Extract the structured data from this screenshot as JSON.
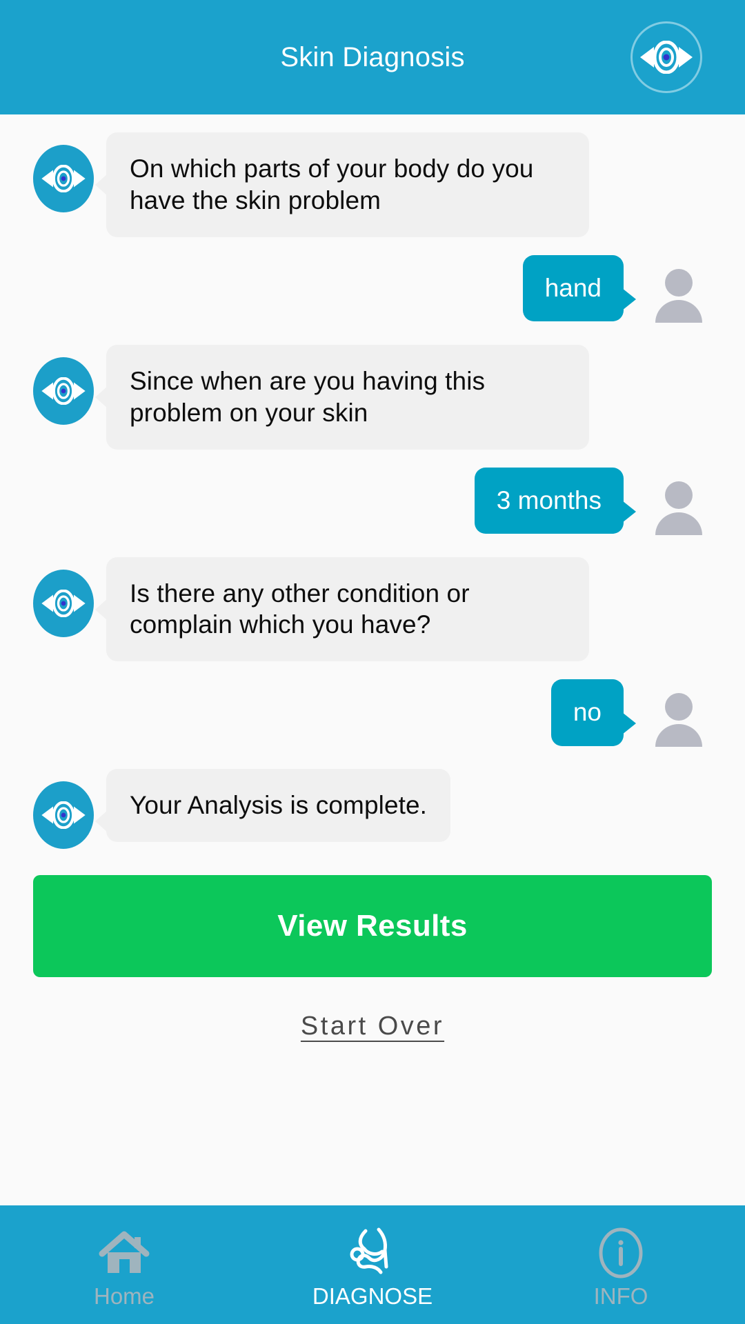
{
  "header": {
    "title": "Skin Diagnosis",
    "logo_icon": "eye-arrows-logo-icon"
  },
  "theme": {
    "header_bg": "#1BA2CC",
    "bot_avatar_bg": "#1C9FC9",
    "bot_bubble_bg": "#f0f0f0",
    "user_bubble_bg": "#00A2C4",
    "page_bg": "#fafafa",
    "primary_button_bg": "#0CC75A",
    "user_avatar_gray": "#B8BAC4",
    "nav_inactive": "#9FB4BE",
    "nav_active": "#FFFFFF"
  },
  "chat": {
    "messages": [
      {
        "sender": "bot",
        "text": "On which parts of your body do you have the skin problem"
      },
      {
        "sender": "user",
        "text": "hand"
      },
      {
        "sender": "bot",
        "text": "Since when are you having this problem on your skin"
      },
      {
        "sender": "user",
        "text": "3 months"
      },
      {
        "sender": "bot",
        "text": "Is there any other condition or complain which you have?"
      },
      {
        "sender": "user",
        "text": "no"
      },
      {
        "sender": "bot",
        "text": "Your Analysis is complete."
      }
    ]
  },
  "actions": {
    "view_results_label": "View Results",
    "start_over_label": "Start Over"
  },
  "bottom_nav": {
    "items": [
      {
        "label": "Home",
        "icon": "home-icon",
        "active": false
      },
      {
        "label": "DIAGNOSE",
        "icon": "stethoscope-icon",
        "active": true
      },
      {
        "label": "INFO",
        "icon": "info-circle-icon",
        "active": false
      }
    ]
  }
}
